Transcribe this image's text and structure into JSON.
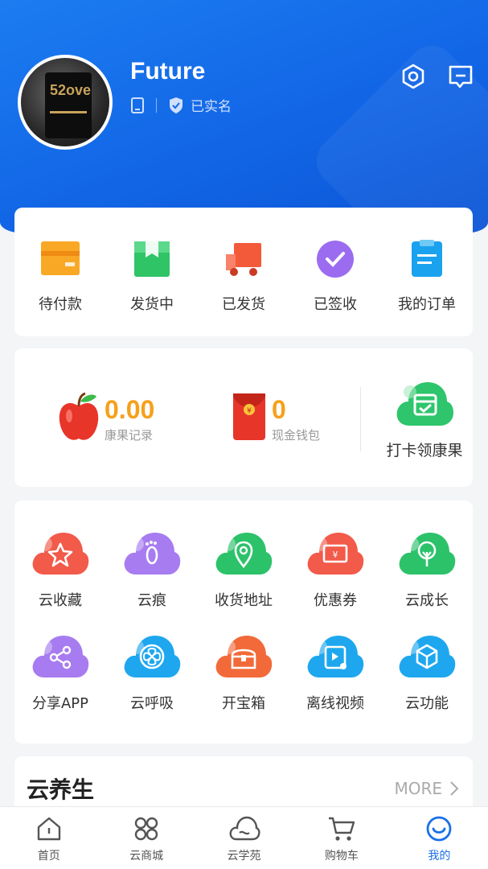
{
  "profile": {
    "username": "Future",
    "verified_label": "已实名",
    "avatar_text": "52ove"
  },
  "orders": [
    {
      "label": "待付款",
      "icon": "wallet-icon"
    },
    {
      "label": "发货中",
      "icon": "package-icon"
    },
    {
      "label": "已发货",
      "icon": "truck-icon"
    },
    {
      "label": "已签收",
      "icon": "check-circle-icon"
    },
    {
      "label": "我的订单",
      "icon": "order-list-icon"
    }
  ],
  "assets": {
    "points_value": "0.00",
    "points_label": "康果记录",
    "wallet_value": "0",
    "wallet_label": "现金钱包",
    "checkin_label": "打卡领康果",
    "yen_symbol": "¥"
  },
  "services": [
    {
      "label": "云收藏",
      "icon": "star-icon",
      "color": "#f25a4a"
    },
    {
      "label": "云痕",
      "icon": "footprint-icon",
      "color": "#a77cf0"
    },
    {
      "label": "收货地址",
      "icon": "location-icon",
      "color": "#2cc26a"
    },
    {
      "label": "优惠券",
      "icon": "coupon-icon",
      "color": "#f25a4a"
    },
    {
      "label": "云成长",
      "icon": "tree-icon",
      "color": "#2cc26a"
    },
    {
      "label": "分享APP",
      "icon": "share-icon",
      "color": "#a77cf0"
    },
    {
      "label": "云呼吸",
      "icon": "fan-icon",
      "color": "#1ea7ef"
    },
    {
      "label": "开宝箱",
      "icon": "treasure-chest-icon",
      "color": "#f26a3a"
    },
    {
      "label": "离线视频",
      "icon": "video-icon",
      "color": "#1ea7ef"
    },
    {
      "label": "云功能",
      "icon": "cube-icon",
      "color": "#1ea7ef"
    }
  ],
  "health": {
    "title": "云养生",
    "more_label": "MORE"
  },
  "tabs": [
    {
      "label": "首页",
      "icon": "home-icon"
    },
    {
      "label": "云商城",
      "icon": "grid-icon"
    },
    {
      "label": "云学苑",
      "icon": "cloud-icon"
    },
    {
      "label": "购物车",
      "icon": "cart-icon"
    },
    {
      "label": "我的",
      "icon": "profile-smile-icon",
      "active": true
    }
  ],
  "colors": {
    "brand_blue": "#1266e6",
    "accent_orange": "#f6a01a",
    "active_tab": "#1a6fe8"
  }
}
